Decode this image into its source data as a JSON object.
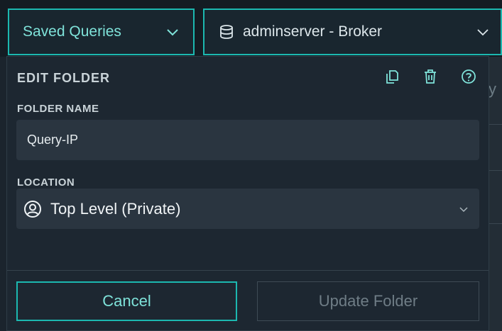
{
  "toolbar": {
    "saved_queries_label": "Saved Queries",
    "server_label": "adminserver - Broker"
  },
  "panel": {
    "title": "EDIT FOLDER",
    "folder_name_label": "FOLDER NAME",
    "folder_name_value": "Query-IP",
    "location_label": "LOCATION",
    "location_value": "Top Level (Private)",
    "cancel_label": "Cancel",
    "update_label": "Update Folder",
    "icons": [
      "copy-icon",
      "trash-icon",
      "help-icon"
    ]
  },
  "background": {
    "fragment_text": "y"
  },
  "colors": {
    "accent": "#1cb8b0",
    "accent_text": "#7fe3da",
    "panel_bg": "#1d2731",
    "input_bg": "#2a3540",
    "page_bg": "#1b242d"
  }
}
